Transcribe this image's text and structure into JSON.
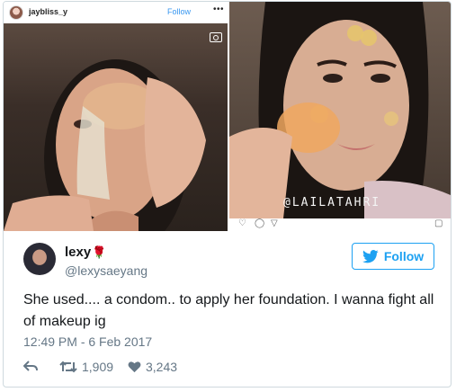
{
  "instagram": {
    "username": "jaybliss_y",
    "follow_label": "Follow",
    "more": "•••",
    "watermark": "@LAILATAHRI"
  },
  "tweet": {
    "display_name": "lexy",
    "name_emoji": "🌹",
    "handle": "@lexysaeyang",
    "follow_label": "Follow",
    "text": "She used.... a condom.. to apply her foundation. I wanna fight all of makeup ig",
    "timestamp": "12:49 PM - 6 Feb 2017",
    "retweets": "1,909",
    "likes": "3,243"
  },
  "colors": {
    "twitter_blue": "#1da1f2",
    "instagram_blue": "#3897f0",
    "muted_gray": "#657786",
    "rose_red": "#d93b3b"
  },
  "icons": [
    "reply-icon",
    "retweet-icon",
    "heart-icon",
    "twitter-bird-icon",
    "camera-icon"
  ]
}
